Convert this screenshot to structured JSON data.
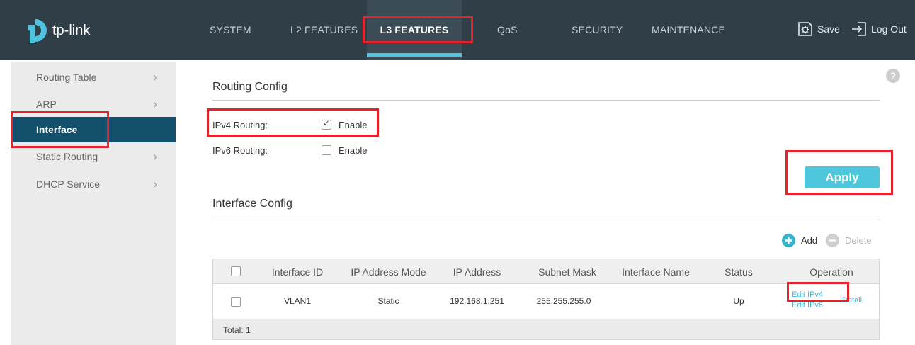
{
  "brand": {
    "name": "tp-link",
    "accent": "#4fc3dd"
  },
  "nav": {
    "items": [
      "SYSTEM",
      "L2 FEATURES",
      "L3 FEATURES",
      "QoS",
      "SECURITY",
      "MAINTENANCE"
    ],
    "active": "L3 FEATURES",
    "save_label": "Save",
    "logout_label": "Log Out"
  },
  "sidebar": {
    "items": [
      {
        "label": "Routing Table",
        "has_arrow": true
      },
      {
        "label": "ARP",
        "has_arrow": true
      },
      {
        "label": "Interface",
        "has_arrow": false,
        "active": true
      },
      {
        "label": "Static Routing",
        "has_arrow": true
      },
      {
        "label": "DHCP Service",
        "has_arrow": true
      }
    ]
  },
  "routing_config": {
    "title": "Routing Config",
    "ipv4_label": "IPv4 Routing:",
    "ipv4_enabled": true,
    "ipv6_label": "IPv6 Routing:",
    "ipv6_enabled": false,
    "enable_label": "Enable",
    "apply_label": "Apply",
    "help_icon": "?"
  },
  "interface_config": {
    "title": "Interface Config",
    "add_label": "Add",
    "delete_label": "Delete",
    "columns": [
      "Interface ID",
      "IP Address Mode",
      "IP Address",
      "Subnet Mask",
      "Interface Name",
      "Status",
      "Operation"
    ],
    "rows": [
      {
        "interface_id": "VLAN1",
        "ip_mode": "Static",
        "ip_address": "192.168.1.251",
        "subnet_mask": "255.255.255.0",
        "interface_name": "",
        "status": "Up",
        "op_edit_ipv4": "Edit IPv4",
        "op_edit_ipv6": "Edit IPv6",
        "op_detail": "Detail"
      }
    ],
    "total_label": "Total: 1"
  }
}
